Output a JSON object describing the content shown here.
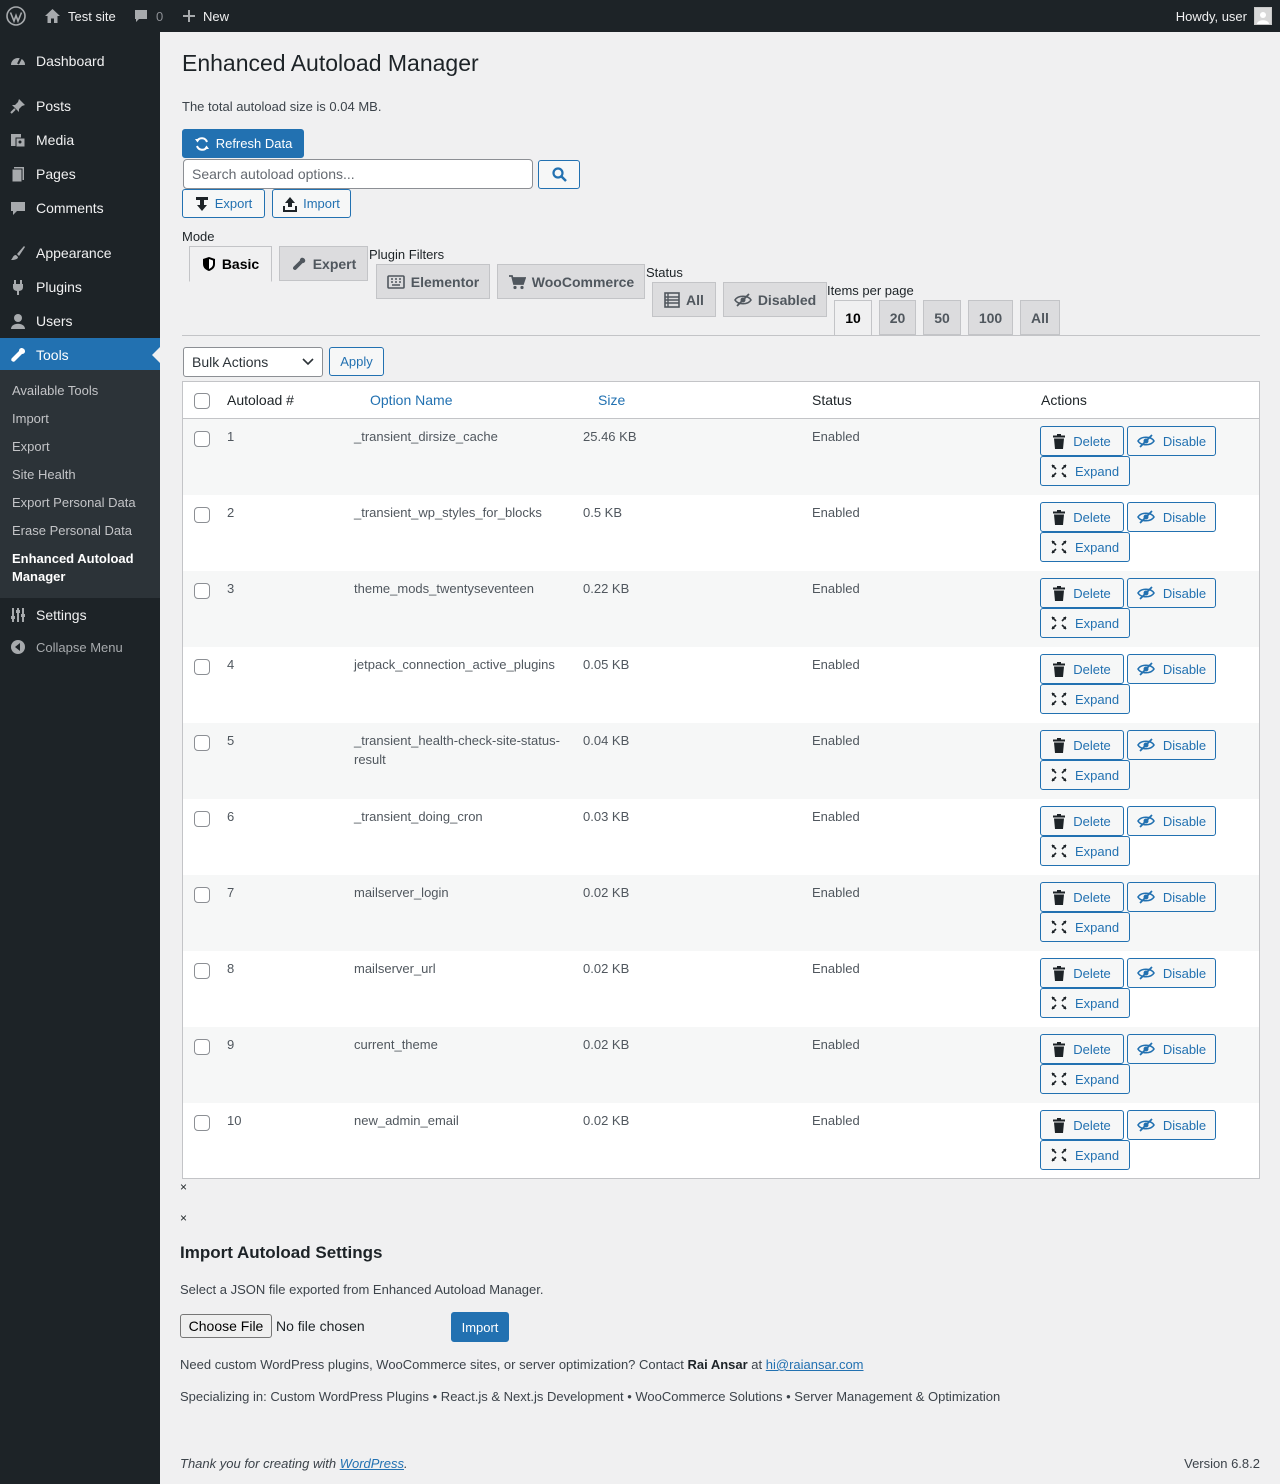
{
  "adminbar": {
    "site_name": "Test site",
    "comments_count": "0",
    "new_label": "New",
    "howdy": "Howdy, user"
  },
  "sidebar": {
    "items": [
      {
        "label": "Dashboard",
        "icon": "dashboard-icon"
      },
      {
        "label": "Posts",
        "icon": "pin-icon"
      },
      {
        "label": "Media",
        "icon": "media-icon"
      },
      {
        "label": "Pages",
        "icon": "pages-icon"
      },
      {
        "label": "Comments",
        "icon": "comment-icon"
      },
      {
        "label": "Appearance",
        "icon": "brush-icon"
      },
      {
        "label": "Plugins",
        "icon": "plug-icon"
      },
      {
        "label": "Users",
        "icon": "user-icon"
      },
      {
        "label": "Tools",
        "icon": "wrench-icon"
      },
      {
        "label": "Settings",
        "icon": "sliders-icon"
      }
    ],
    "submenu": [
      "Available Tools",
      "Import",
      "Export",
      "Site Health",
      "Export Personal Data",
      "Erase Personal Data",
      "Enhanced Autoload Manager"
    ],
    "collapse_label": "Collapse Menu"
  },
  "main": {
    "title": "Enhanced Autoload Manager",
    "total_size_text": "The total autoload size is 0.04 MB.",
    "refresh_label": "Refresh Data",
    "search_placeholder": "Search autoload options...",
    "export_label": "Export",
    "import_label": "Import",
    "mode_label": "Mode",
    "mode_tabs": [
      "Basic",
      "Expert"
    ],
    "plugin_filters_label": "Plugin Filters",
    "plugin_tabs": [
      "Elementor",
      "WooCommerce"
    ],
    "status_label": "Status",
    "status_tabs": [
      "All",
      "Disabled"
    ],
    "per_page_label": "Items per page",
    "per_page_tabs": [
      "10",
      "20",
      "50",
      "100",
      "All"
    ],
    "bulk_actions": "Bulk Actions",
    "apply_label": "Apply"
  },
  "table": {
    "headers": [
      "Autoload #",
      "Option Name",
      "Size",
      "Status",
      "Actions"
    ],
    "rows": [
      {
        "num": "1",
        "name": "_transient_dirsize_cache",
        "size": "25.46 KB",
        "status": "Enabled"
      },
      {
        "num": "2",
        "name": "_transient_wp_styles_for_blocks",
        "size": "0.5 KB",
        "status": "Enabled"
      },
      {
        "num": "3",
        "name": "theme_mods_twentyseventeen",
        "size": "0.22 KB",
        "status": "Enabled"
      },
      {
        "num": "4",
        "name": "jetpack_connection_active_plugins",
        "size": "0.05 KB",
        "status": "Enabled"
      },
      {
        "num": "5",
        "name": "_transient_health-check-site-status-result",
        "size": "0.04 KB",
        "status": "Enabled"
      },
      {
        "num": "6",
        "name": "_transient_doing_cron",
        "size": "0.03 KB",
        "status": "Enabled"
      },
      {
        "num": "7",
        "name": "mailserver_login",
        "size": "0.02 KB",
        "status": "Enabled"
      },
      {
        "num": "8",
        "name": "mailserver_url",
        "size": "0.02 KB",
        "status": "Enabled"
      },
      {
        "num": "9",
        "name": "current_theme",
        "size": "0.02 KB",
        "status": "Enabled"
      },
      {
        "num": "10",
        "name": "new_admin_email",
        "size": "0.02 KB",
        "status": "Enabled"
      }
    ],
    "row_actions": [
      "Delete",
      "Disable",
      "Expand"
    ]
  },
  "close_glyph": "×",
  "import_section": {
    "title": "Import Autoload Settings",
    "description": "Select a JSON file exported from Enhanced Autoload Manager.",
    "choose_file": "Choose File",
    "no_file": "No file chosen",
    "import_button": "Import"
  },
  "footer": {
    "contact_prefix": "Need custom WordPress plugins, WooCommerce sites, or server optimization? Contact",
    "contact_name": "Rai Ansar",
    "contact_at": "at",
    "contact_email": "hi@raiansar.com",
    "specializing": "Specializing in: Custom WordPress Plugins • React.js & Next.js Development • WooCommerce Solutions • Server Management & Optimization",
    "thanks_prefix": "Thank you for creating with",
    "thanks_link": "WordPress",
    "thanks_suffix": ".",
    "version": "Version 6.8.2"
  },
  "colors": {
    "accent": "#2271b1",
    "sidebar_bg": "#1d2327",
    "submenu_bg": "#2c3338",
    "page_bg": "#f0f0f1"
  }
}
